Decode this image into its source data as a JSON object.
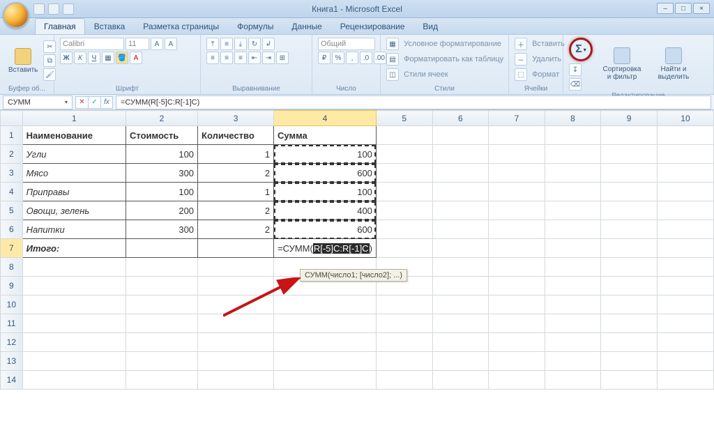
{
  "window": {
    "title": "Книга1 - Microsoft Excel"
  },
  "tabs": {
    "home": "Главная",
    "insert": "Вставка",
    "layout": "Разметка страницы",
    "formulas": "Формулы",
    "data": "Данные",
    "review": "Рецензирование",
    "view": "Вид"
  },
  "ribbon": {
    "clipboard": {
      "paste": "Вставить",
      "label": "Буфер об..."
    },
    "font": {
      "name": "Calibri",
      "size": "11",
      "label": "Шрифт"
    },
    "alignment": {
      "label": "Выравнивание"
    },
    "number": {
      "format": "Общий",
      "label": "Число"
    },
    "styles": {
      "cond": "Условное форматирование",
      "table": "Форматировать как таблицу",
      "cell": "Стили ячеек",
      "label": "Стили"
    },
    "cells": {
      "insert": "Вставить",
      "delete": "Удалить",
      "format": "Формат",
      "label": "Ячейки"
    },
    "editing": {
      "sum": "Σ",
      "sort": "Сортировка и фильтр",
      "find": "Найти и выделить",
      "label": "Редактирование"
    }
  },
  "formula_bar": {
    "name": "СУММ",
    "formula": "=СУММ(R[-5]C:R[-1]C)"
  },
  "columns": [
    "1",
    "2",
    "3",
    "4",
    "5",
    "6",
    "7",
    "8",
    "9",
    "10"
  ],
  "active_col_index": 3,
  "headers": {
    "c1": "Наименование",
    "c2": "Стоимость",
    "c3": "Количество",
    "c4": "Сумма"
  },
  "data_rows": [
    {
      "name": "Угли",
      "cost": "100",
      "qty": "1",
      "sum": "100"
    },
    {
      "name": "Мясо",
      "cost": "300",
      "qty": "2",
      "sum": "600"
    },
    {
      "name": "Приправы",
      "cost": "100",
      "qty": "1",
      "sum": "100"
    },
    {
      "name": "Овощи, зелень",
      "cost": "200",
      "qty": "2",
      "sum": "400"
    },
    {
      "name": "Напитки",
      "cost": "300",
      "qty": "2",
      "sum": "600"
    }
  ],
  "total_label": "Итого:",
  "editing_cell": {
    "prefix": "=СУММ(",
    "sel": "R[-5]C:R[-1]C",
    "suffix": ")"
  },
  "tooltip": "СУММ(число1; [число2]; ...)",
  "col_widths": {
    "rowhdr": 34,
    "c1": 154,
    "c2": 106,
    "c3": 112,
    "c4": 78,
    "rest": 90
  }
}
